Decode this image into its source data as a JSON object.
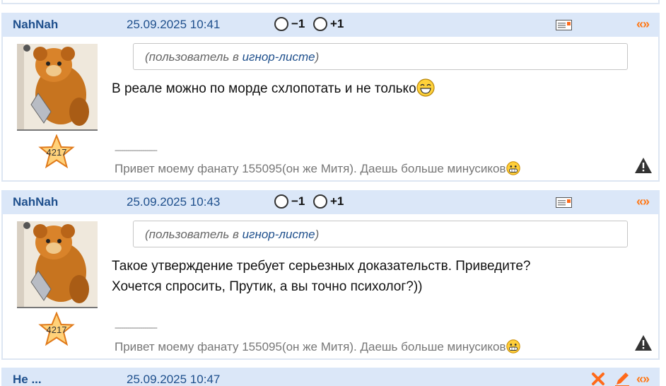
{
  "posts": [
    {
      "author": "NahNah",
      "date": "25.09.2025 10:41",
      "vote_minus": "−1",
      "vote_plus": "+1",
      "quote_label": "«»",
      "rating": "4217",
      "ignore_prefix": "(пользователь в ",
      "ignore_link": "игнор-листе",
      "ignore_suffix": ")",
      "text_lines": [
        "В реале можно по морде схлопотать и не только"
      ],
      "signature_separator": "--------------------",
      "signature": "Привет моему фанату 155095(он же Митя). Даешь больше минусиков"
    },
    {
      "author": "NahNah",
      "date": "25.09.2025 10:43",
      "vote_minus": "−1",
      "vote_plus": "+1",
      "quote_label": "«»",
      "rating": "4217",
      "ignore_prefix": "(пользователь в ",
      "ignore_link": "игнор-листе",
      "ignore_suffix": ")",
      "text_lines": [
        "Такое утверждение требует серьезных доказательств. Приведите?",
        "Хочется спросить, Прутик, а вы точно психолог?))"
      ],
      "signature_separator": "--------------------",
      "signature": "Привет моему фанату 155095(он же Митя). Даешь больше минусиков"
    },
    {
      "author": "Не ...",
      "date": "25.09.2025 10:47",
      "quote_label": "«»"
    }
  ],
  "icons": {
    "message": "message-icon",
    "warning": "warning-icon",
    "delete": "delete-icon",
    "edit": "edit-icon",
    "smile": "laughing-smiley-icon",
    "grin": "grin-smiley-icon",
    "star": "rating-star-icon"
  },
  "colors": {
    "header_bg": "#dbe7f8",
    "author": "#1e4f8c",
    "quote_accent": "#ff7a1a"
  }
}
